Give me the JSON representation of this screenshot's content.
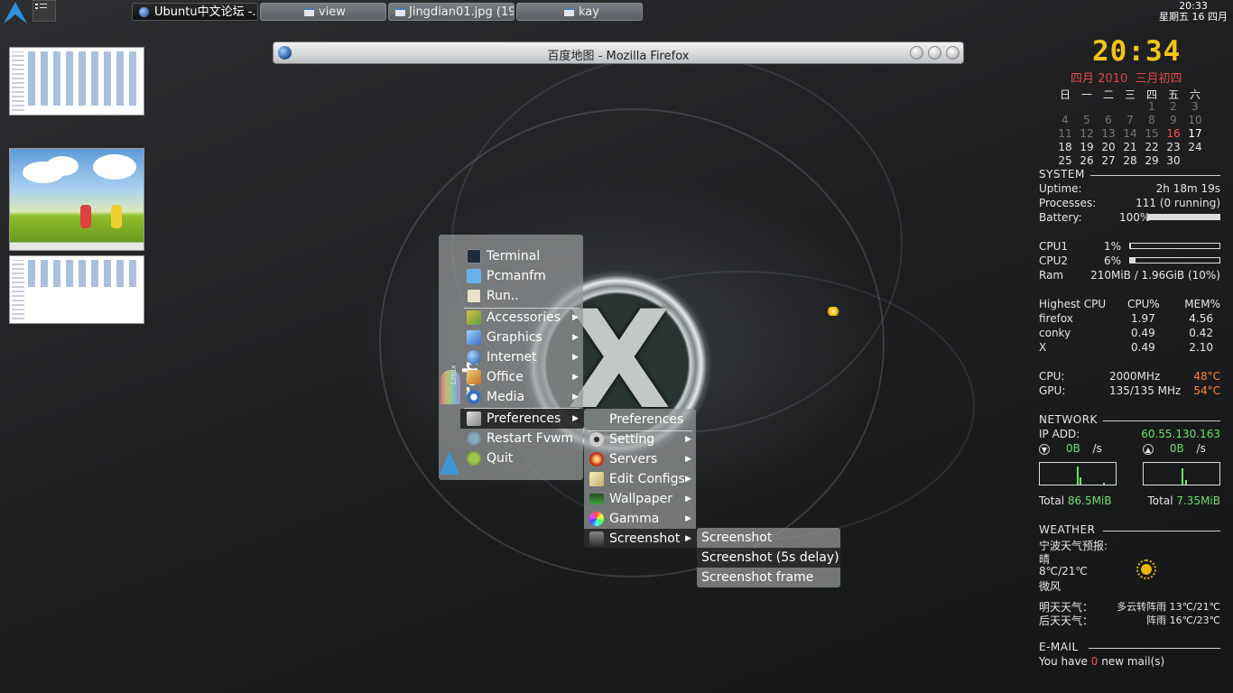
{
  "taskbar": {
    "tasks": [
      {
        "label": "Ubuntu中文论坛 -..."
      },
      {
        "label": "view"
      },
      {
        "label": "Jingdian01.jpg (19..."
      },
      {
        "label": "kay"
      }
    ],
    "clock_time": "20:33",
    "clock_date": "星期五 16 四月"
  },
  "firefox": {
    "title": "百度地图 - Mozilla Firefox"
  },
  "main_menu": {
    "items": [
      {
        "label": "Terminal",
        "icon": "terminal-icon"
      },
      {
        "label": "Pcmanfm",
        "icon": "folder-icon"
      },
      {
        "label": "Run..",
        "icon": "run-icon"
      },
      {
        "label": "Accessories",
        "icon": "accessories-icon"
      },
      {
        "label": "Graphics",
        "icon": "graphics-icon"
      },
      {
        "label": "Internet",
        "icon": "globe-icon"
      },
      {
        "label": "Office",
        "icon": "office-icon"
      },
      {
        "label": "Media",
        "icon": "media-icon"
      },
      {
        "label": "Preferences",
        "icon": "preferences-icon"
      },
      {
        "label": "Restart Fvwm",
        "icon": "restart-icon"
      },
      {
        "label": "Quit",
        "icon": "quit-icon"
      }
    ],
    "side_text": "rch",
    "side_small": "Linux"
  },
  "pref_menu": {
    "items": [
      {
        "label": "Preferences"
      },
      {
        "label": "Setting"
      },
      {
        "label": "Servers"
      },
      {
        "label": "Edit Configs"
      },
      {
        "label": "Wallpaper"
      },
      {
        "label": "Gamma"
      },
      {
        "label": "Screenshot"
      }
    ]
  },
  "shot_menu": {
    "items": [
      {
        "label": "Screenshot"
      },
      {
        "label": "Screenshot (5s delay)"
      },
      {
        "label": "Screenshot frame"
      }
    ]
  },
  "conky": {
    "time": "20:34",
    "cal_month": "四月 2010",
    "cal_lunar": "三月初四",
    "weekdays": [
      "日",
      "一",
      "二",
      "三",
      "四",
      "五",
      "六"
    ],
    "weeks": [
      [
        "",
        "",
        "",
        "",
        "1",
        "2",
        "3"
      ],
      [
        "4",
        "5",
        "6",
        "7",
        "8",
        "9",
        "10"
      ],
      [
        "11",
        "12",
        "13",
        "14",
        "15",
        "16",
        "17"
      ],
      [
        "18",
        "19",
        "20",
        "21",
        "22",
        "23",
        "24"
      ],
      [
        "25",
        "26",
        "27",
        "28",
        "29",
        "30",
        ""
      ]
    ],
    "today": "16",
    "system": {
      "title": "SYSTEM",
      "uptime_label": "Uptime:",
      "uptime": "2h 18m 19s",
      "proc_label": "Processes:",
      "proc": "111 (0 running)",
      "batt_label": "Battery:",
      "batt": "100%",
      "batt_level": 100,
      "cpu1_label": "CPU1",
      "cpu1": "1%",
      "cpu1_level": 1,
      "cpu2_label": "CPU2",
      "cpu2": "6%",
      "cpu2_level": 6,
      "ram_label": "Ram",
      "ram": "210MiB / 1.96GiB (10%)"
    },
    "top": {
      "head": [
        "Highest CPU",
        "CPU%",
        "MEM%"
      ],
      "rows": [
        [
          "firefox",
          "1.97",
          "4.56"
        ],
        [
          "conky",
          "0.49",
          "0.42"
        ],
        [
          "X",
          "0.49",
          "2.10"
        ]
      ]
    },
    "temps": {
      "cpu_label": "CPU:",
      "cpu_freq": "2000MHz",
      "cpu_temp": "48°C",
      "gpu_label": "GPU:",
      "gpu_freq": "135/135 MHz",
      "gpu_temp": "54°C"
    },
    "network": {
      "title": "NETWORK",
      "ip_label": "IP ADD:",
      "ip": "60.55.130.163",
      "down": "0B",
      "up": "0B",
      "unit": "/s",
      "total_label": "Total",
      "total_down": "86.5MiB",
      "total_up": "7.35MiB"
    },
    "weather": {
      "title": "WEATHER",
      "city": "宁波天气预报:",
      "cond": "晴",
      "temp": "8℃/21℃",
      "wind": "微风",
      "tomorrow_label": "明天天气：",
      "tomorrow": "多云转阵雨 13℃/21℃",
      "after_label": "后天天气：",
      "after": "阵雨 16℃/23℃"
    },
    "email": {
      "title": "E-MAIL",
      "pre": "You have",
      "count": "0",
      "post": "new mail(s)"
    }
  }
}
